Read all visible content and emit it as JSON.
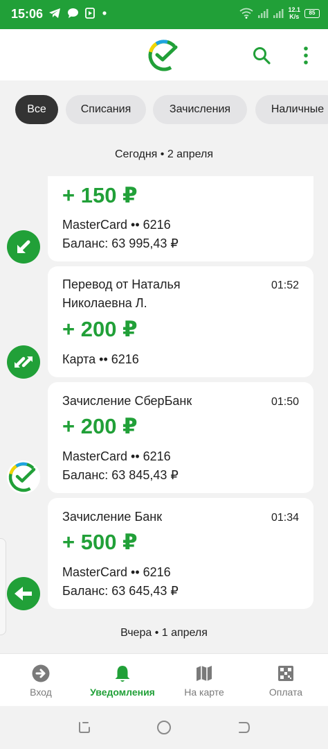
{
  "status_bar": {
    "time": "15:06",
    "speed_value": "12.1",
    "speed_unit": "K/s",
    "battery": "85"
  },
  "app_bar": {
    "logo_icon": "sber-logo-icon",
    "search_icon": "search-icon",
    "more_icon": "more-vertical-icon"
  },
  "filters": [
    {
      "label": "Все",
      "active": true
    },
    {
      "label": "Списания",
      "active": false
    },
    {
      "label": "Зачисления",
      "active": false
    },
    {
      "label": "Наличные",
      "active": false
    }
  ],
  "sections": {
    "today": "Сегодня • 2 апреля",
    "yesterday": "Вчера • 1 апреля"
  },
  "notifications": [
    {
      "title": "",
      "time": "",
      "amount": "+ 150 ₽",
      "card": "MasterCard •• 6216",
      "balance": "Баланс: 63 995,43 ₽",
      "icon": "arrow-down-left-icon"
    },
    {
      "title": "Перевод от Наталья\nНиколаевна Л.",
      "time": "01:52",
      "amount": "+ 200 ₽",
      "card": "Карта •• 6216",
      "balance": "",
      "icon": "transfer-arrows-icon"
    },
    {
      "title": "Зачисление СберБанк",
      "time": "01:50",
      "amount": "+ 200 ₽",
      "card": "MasterCard •• 6216",
      "balance": "Баланс: 63 845,43 ₽",
      "icon": "sber-logo-icon"
    },
    {
      "title": "Зачисление Банк",
      "time": "01:34",
      "amount": "+ 500 ₽",
      "card": "MasterCard •• 6216",
      "balance": "Баланс: 63 645,43 ₽",
      "icon": "arrow-left-icon"
    }
  ],
  "bottom_nav": [
    {
      "label": "Вход",
      "icon": "login-icon",
      "active": false
    },
    {
      "label": "Уведомления",
      "icon": "bell-icon",
      "active": true
    },
    {
      "label": "На карте",
      "icon": "map-icon",
      "active": false
    },
    {
      "label": "Оплата",
      "icon": "qr-code-icon",
      "active": false
    }
  ],
  "colors": {
    "brand_green": "#21a038",
    "chip_active": "#333333",
    "chip_inactive": "#e4e4e6"
  }
}
